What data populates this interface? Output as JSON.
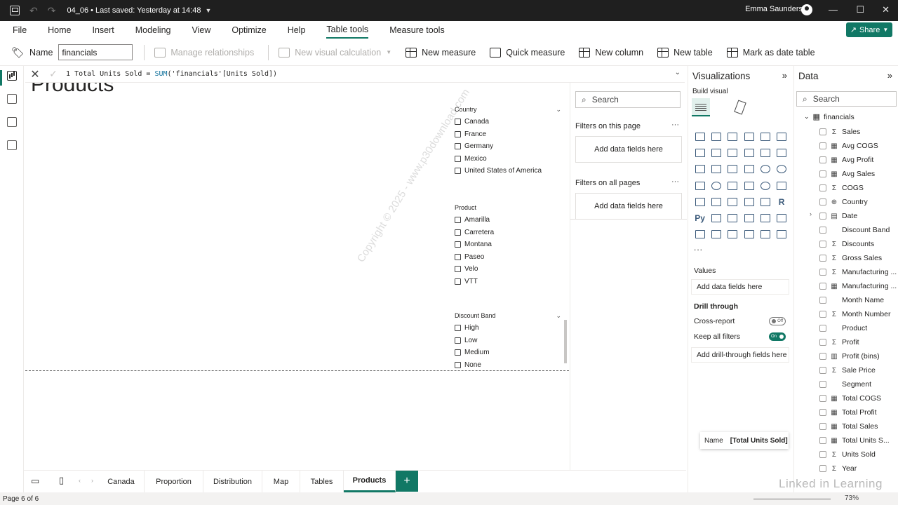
{
  "titlebar": {
    "doc_title": "04_06 • Last saved: Yesterday at 14:48",
    "user_name": "Emma Saunders"
  },
  "menu": {
    "items": [
      "File",
      "Home",
      "Insert",
      "Modeling",
      "View",
      "Optimize",
      "Help",
      "Table tools",
      "Measure tools"
    ],
    "active": "Table tools",
    "share_label": "Share"
  },
  "ribbon": {
    "name_label": "Name",
    "name_value": "financials",
    "manage_relationships": "Manage relationships",
    "new_visual_calculation": "New visual calculation",
    "new_measure": "New measure",
    "quick_measure": "Quick measure",
    "new_column": "New column",
    "new_table": "New table",
    "mark_as_date_table": "Mark as date table"
  },
  "formula": {
    "line_number": "1",
    "prefix": "Total Units Sold = ",
    "function": "SUM",
    "args": "('financials'[Units Sold])"
  },
  "canvas": {
    "page_title": "Products",
    "watermark": "Copyright © 2025 - www.p30download.com",
    "slicers": {
      "country": {
        "title": "Country",
        "options": [
          "Canada",
          "France",
          "Germany",
          "Mexico",
          "United States of America"
        ]
      },
      "product": {
        "title": "Product",
        "options": [
          "Amarilla",
          "Carretera",
          "Montana",
          "Paseo",
          "Velo",
          "VTT"
        ]
      },
      "discount_band": {
        "title": "Discount Band",
        "options": [
          "High",
          "Low",
          "Medium",
          "None"
        ]
      }
    }
  },
  "filters": {
    "search_placeholder": "Search",
    "on_this_page": "Filters on this page",
    "on_all_pages": "Filters on all pages",
    "add_fields": "Add data fields here"
  },
  "visualizations": {
    "title": "Visualizations",
    "build_visual": "Build visual",
    "values_label": "Values",
    "values_placeholder": "Add data fields here",
    "drill_through": "Drill through",
    "cross_report": "Cross-report",
    "cross_report_state": "Off",
    "keep_all_filters": "Keep all filters",
    "keep_all_filters_state": "On",
    "drill_placeholder": "Add drill-through fields here",
    "more": "..."
  },
  "data_pane": {
    "title": "Data",
    "search_placeholder": "Search",
    "table_name": "financials",
    "fields": [
      {
        "type": "Σ",
        "name": "Sales"
      },
      {
        "type": "▦",
        "name": "Avg COGS"
      },
      {
        "type": "▦",
        "name": "Avg Profit"
      },
      {
        "type": "▦",
        "name": "Avg Sales"
      },
      {
        "type": "Σ",
        "name": "COGS"
      },
      {
        "type": "⊕",
        "name": "Country"
      },
      {
        "type": "▤",
        "name": "Date"
      },
      {
        "type": "",
        "name": "Discount Band"
      },
      {
        "type": "Σ",
        "name": "Discounts"
      },
      {
        "type": "Σ",
        "name": "Gross Sales"
      },
      {
        "type": "Σ",
        "name": "Manufacturing ..."
      },
      {
        "type": "▦",
        "name": "Manufacturing ..."
      },
      {
        "type": "",
        "name": "Month Name"
      },
      {
        "type": "Σ",
        "name": "Month Number"
      },
      {
        "type": "",
        "name": "Product"
      },
      {
        "type": "Σ",
        "name": "Profit"
      },
      {
        "type": "▥",
        "name": "Profit (bins)"
      },
      {
        "type": "Σ",
        "name": "Sale Price"
      },
      {
        "type": "",
        "name": "Segment"
      },
      {
        "type": "▦",
        "name": "Total COGS"
      },
      {
        "type": "▦",
        "name": "Total Profit"
      },
      {
        "type": "▦",
        "name": "Total Sales"
      },
      {
        "type": "▦",
        "name": "Total Units S..."
      },
      {
        "type": "Σ",
        "name": "Units Sold"
      },
      {
        "type": "Σ",
        "name": "Year"
      }
    ],
    "tooltip_label": "Name",
    "tooltip_value": "[Total Units Sold]"
  },
  "tabs": {
    "items": [
      "Canada",
      "Proportion",
      "Distribution",
      "Map",
      "Tables",
      "Products"
    ],
    "active": "Products"
  },
  "status": {
    "page": "Page 6 of 6",
    "zoom": "73%",
    "brand": "Linked in Learning"
  },
  "colors": {
    "accent": "#117865",
    "titlebar": "#1f1f1f"
  }
}
